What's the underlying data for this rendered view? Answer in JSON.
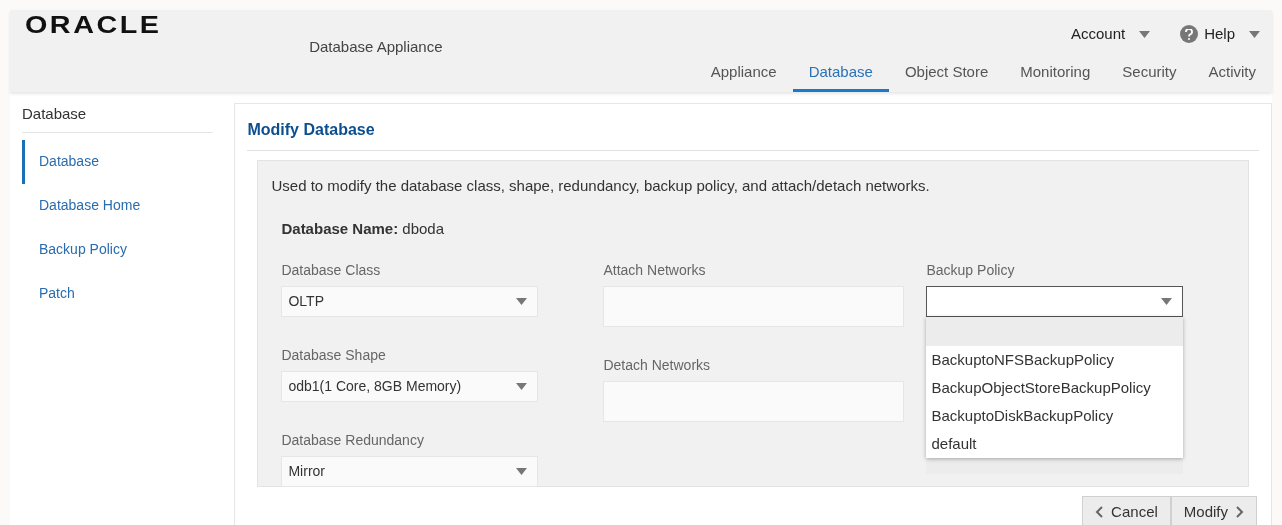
{
  "header": {
    "logo": "ORACLE",
    "product": "Database Appliance",
    "menus": [
      {
        "label": "Account",
        "kind": "plain"
      },
      {
        "label": "Help",
        "kind": "help"
      }
    ],
    "tabs": [
      {
        "label": "Appliance",
        "selected": false
      },
      {
        "label": "Database",
        "selected": true
      },
      {
        "label": "Object Store",
        "selected": false
      },
      {
        "label": "Monitoring",
        "selected": false
      },
      {
        "label": "Security",
        "selected": false
      },
      {
        "label": "Activity",
        "selected": false
      }
    ]
  },
  "sidebar": {
    "title": "Database",
    "items": [
      {
        "label": "Database",
        "selected": true
      },
      {
        "label": "Database Home",
        "selected": false
      },
      {
        "label": "Backup Policy",
        "selected": false
      },
      {
        "label": "Patch",
        "selected": false
      }
    ]
  },
  "form": {
    "title": "Modify Database",
    "description": "Used to modify the database class, shape, redundancy, backup policy, and attach/detach networks.",
    "name_label": "Database Name:",
    "name_value": "dboda",
    "columns": [
      [
        {
          "label": "Database Class",
          "kind": "select",
          "value": "OLTP"
        },
        {
          "label": "Database Shape",
          "kind": "select",
          "value": "odb1(1 Core, 8GB Memory)"
        },
        {
          "label": "Database Redundancy",
          "kind": "select",
          "value": "Mirror"
        }
      ],
      [
        {
          "label": "Attach Networks",
          "kind": "multi"
        },
        {
          "label": "Detach Networks",
          "kind": "multi"
        }
      ],
      [
        {
          "label": "Backup Policy",
          "kind": "select",
          "open": true,
          "options": [
            "BackuptoNFSBackupPolicy",
            "BackupObjectStoreBackupPolicy",
            "BackuptoDiskBackupPolicy",
            "default"
          ]
        }
      ]
    ]
  },
  "buttons": [
    {
      "label": "Cancel",
      "kind": "back"
    },
    {
      "label": "Modify",
      "kind": "next"
    }
  ]
}
